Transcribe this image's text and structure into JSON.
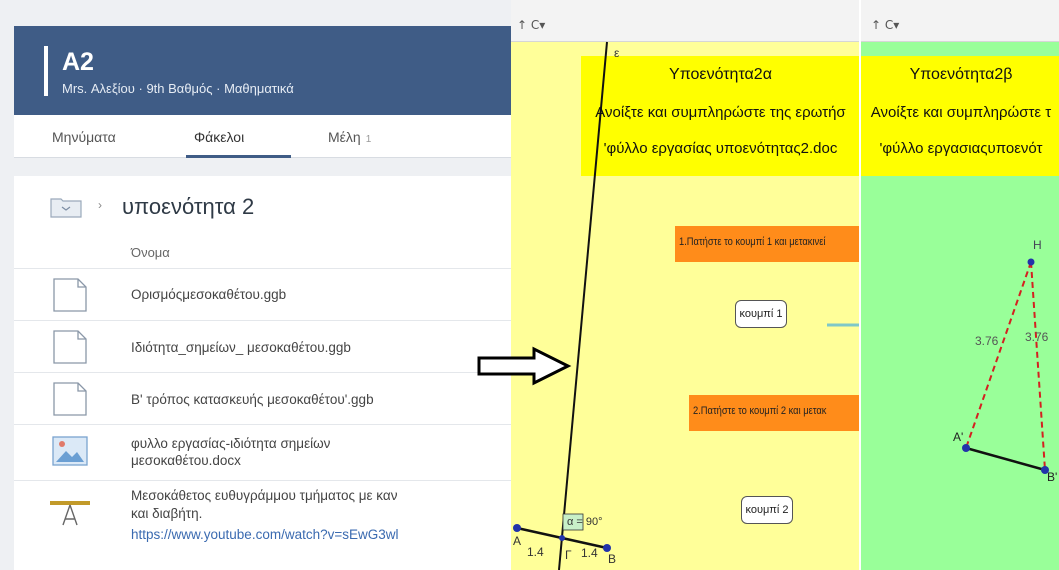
{
  "classroom": {
    "title": "A2",
    "subtitle": "Mrs. Αλεξίου · 9th Βαθμός · Μαθηματικά",
    "tabs": [
      {
        "label": "Μηνύματα"
      },
      {
        "label": "Φάκελοι"
      },
      {
        "label": "Μέλη",
        "badge": "1"
      }
    ],
    "folder": {
      "name": "υποενότητα 2",
      "column_header": "Όνομα"
    },
    "files": [
      {
        "name": "Ορισμόςμεσοκαθέτου.ggb",
        "icon": "document-icon"
      },
      {
        "name": "Ιδιότητα_σημείων_ μεσοκαθέτου.ggb",
        "icon": "document-icon"
      },
      {
        "name": "Β' τρόπος κατασκευής μεσοκαθέτου'.ggb",
        "icon": "document-icon"
      },
      {
        "name_line1": "φυλλο εργασίας-ιδιότητα σημείων",
        "name_line2": "μεσοκαθέτου.docx",
        "icon": "image-icon"
      },
      {
        "name_line1": "Μεσοκάθετος ευθυγράμμου τμήματος με καν",
        "name_line2": "και διαβήτη.",
        "link": "https://www.youtube.com/watch?v=sEwG3wl",
        "icon": "video-thumbnail-icon"
      }
    ]
  },
  "geo_a": {
    "toolbar_text": "↑ C▾",
    "line_label": "ε",
    "heading": {
      "line1": "Υποενότητα2α",
      "line2": "Ανοίξτε και συμπληρώστε της ερωτήσ",
      "line3": "'φύλλο εργασίας υποενότητας2.doc"
    },
    "step1": "1.Πατήστε το κουμπί 1 και μετακινεί",
    "button1": "κουμπί 1",
    "step2": "2.Πατήστε το κουμπί 2 και μετακ",
    "button2": "κουμπί 2",
    "angle_label": "α = 90°",
    "point_a": "A",
    "point_b": "B",
    "point_g": "Γ",
    "seg_left": "1.4",
    "seg_right": "1.4"
  },
  "geo_b": {
    "toolbar_text": "↑ C▾",
    "heading": {
      "line1": "Υποενότητα2β",
      "line2": "Ανοίξτε και συμπληρώστε τ",
      "line3": "'φύλλο εργασιαςυποενότ"
    },
    "point_h": "H",
    "point_a": "A'",
    "point_b": "B'",
    "len_left": "3.76",
    "len_right": "3.76"
  },
  "colors": {
    "header_blue": "#3f5c86",
    "panel_yellow": "#ffff99",
    "heading_yellow": "#ffff00",
    "panel_green": "#99ff99",
    "orange": "#ff8c1a",
    "red_dashed": "#d42020"
  }
}
